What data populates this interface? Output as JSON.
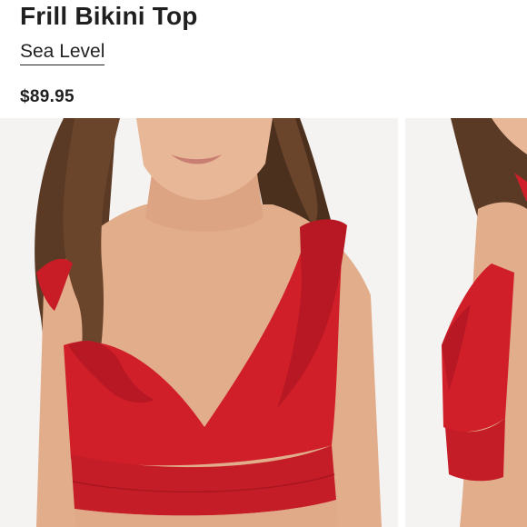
{
  "product": {
    "title": "Frill Bikini Top",
    "brand": "Sea Level",
    "price": "$89.95"
  },
  "gallery": {
    "images": [
      {
        "name": "model-front-view",
        "shown": "main"
      },
      {
        "name": "model-side-view",
        "shown": "partial"
      }
    ]
  },
  "colors": {
    "garment": "#d11f2a",
    "skin": "#e3b08f",
    "hair": "#5a3a25",
    "text": "#1f1f1f"
  }
}
